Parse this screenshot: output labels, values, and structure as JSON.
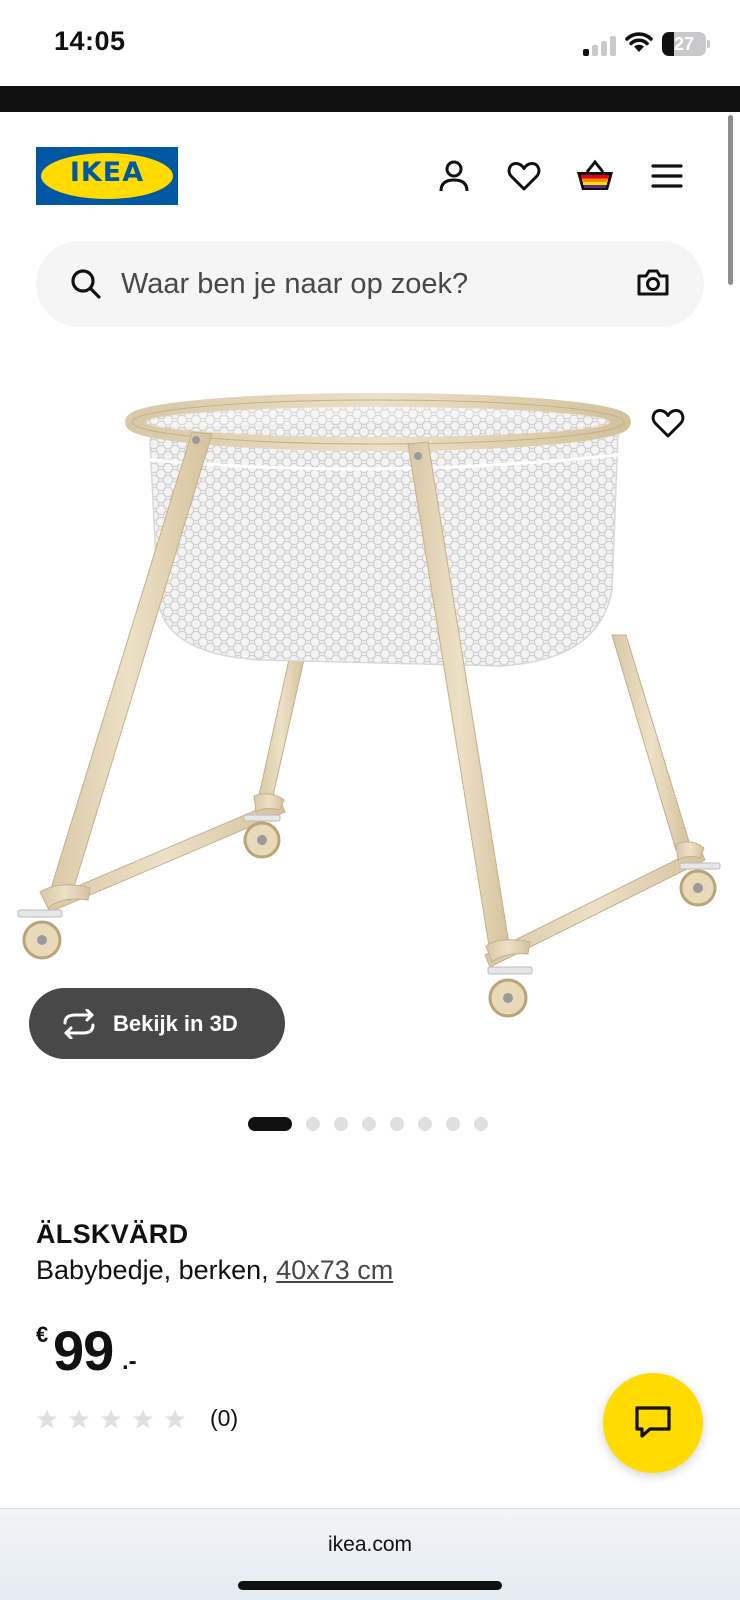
{
  "status_bar": {
    "time": "14:05",
    "battery": "27",
    "battery_level": 0.27,
    "signal_icon": "cellular-signal-icon",
    "wifi_icon": "wifi-icon"
  },
  "header": {
    "logo": "IKEA",
    "icons": [
      "user-icon",
      "heart-icon",
      "shopping-bag-icon",
      "hamburger-menu-icon"
    ]
  },
  "search": {
    "placeholder": "Waar ben je naar op zoek?",
    "icon": "search-icon",
    "camera_icon": "camera-icon"
  },
  "gallery": {
    "view_3d_label": "Bekijk in 3D",
    "image_count": 8,
    "active_index": 0
  },
  "product": {
    "name": "ÄLSKVÄRD",
    "description": "Babybedje, berken,",
    "size": "40x73 cm",
    "price_currency": "€",
    "price_integer": "99",
    "price_decimal": ".-",
    "rating_stars": 5,
    "rating_value": 0,
    "rating_count": "(0)"
  },
  "browser": {
    "url": "ikea.com"
  },
  "colors": {
    "ikea_blue": "#0058a3",
    "ikea_yellow": "#ffdb00",
    "button_dark": "#484848",
    "star_empty": "#dfdfdf"
  }
}
